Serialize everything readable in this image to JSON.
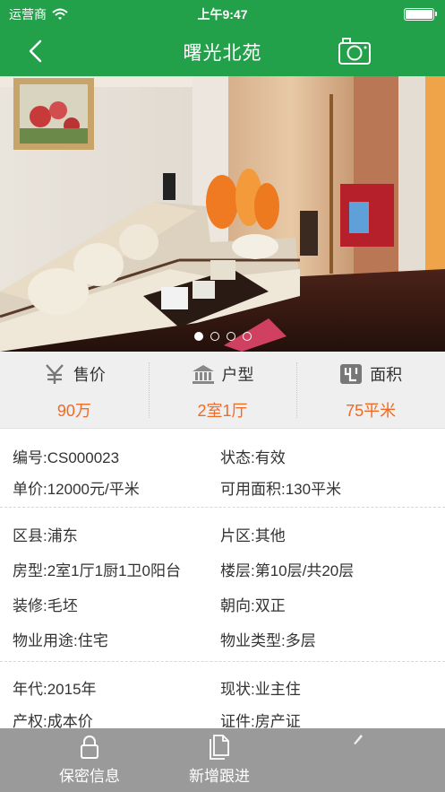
{
  "status_bar": {
    "carrier": "运营商",
    "time": "上午9:47",
    "wifi_icon": "wifi-icon",
    "battery_icon": "battery-icon"
  },
  "header": {
    "title": "曙光北苑",
    "back_icon": "back-chevron-icon",
    "camera_icon": "camera-icon"
  },
  "gallery": {
    "slide_count": 4,
    "active_index": 0
  },
  "summary": [
    {
      "icon": "yen-icon",
      "label": "售价",
      "value": "90万"
    },
    {
      "icon": "house-icon",
      "label": "户型",
      "value": "2室1厅"
    },
    {
      "icon": "area-icon",
      "label": "面积",
      "value": "75平米"
    }
  ],
  "details": {
    "code": "编号:CS000023",
    "status": "状态:有效",
    "unit_price": "单价:12000元/平米",
    "usable_area": "可用面积:130平米",
    "district": "区县:浦东",
    "zone": "片区:其他",
    "layout": "房型:2室1厅1厨1卫0阳台",
    "floor": "楼层:第10层/共20层",
    "decoration": "装修:毛坯",
    "orientation": "朝向:双正",
    "usage": "物业用途:住宅",
    "property_type": "物业类型:多层",
    "year": "年代:2015年",
    "occupancy": "现状:业主住",
    "ownership": "产权:成本价",
    "certificate": "证件:房产证"
  },
  "tabbar": [
    {
      "icon": "lock-icon",
      "label": "保密信息"
    },
    {
      "icon": "document-icon",
      "label": "新增跟进"
    },
    {
      "icon": "pen-icon",
      "label": ""
    }
  ],
  "colors": {
    "brand_green": "#23a04a",
    "accent_orange": "#f26a22",
    "tabbar_gray": "#9a9a9a"
  }
}
